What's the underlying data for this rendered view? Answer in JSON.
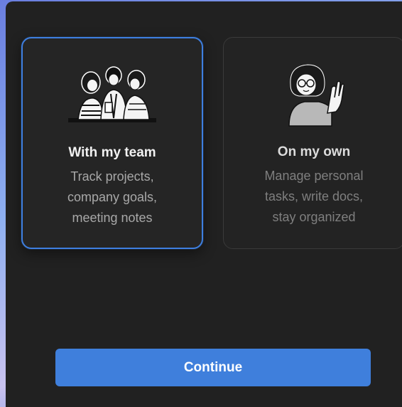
{
  "options": [
    {
      "title": "With my team",
      "description_lines": [
        "Track projects,",
        "company goals,",
        "meeting notes"
      ],
      "selected": true,
      "icon": "team-illustration-icon"
    },
    {
      "title": "On my own",
      "description_lines": [
        "Manage personal",
        "tasks, write docs,",
        "stay organized"
      ],
      "selected": false,
      "icon": "solo-illustration-icon"
    }
  ],
  "continue_label": "Continue",
  "colors": {
    "accent": "#3f7fdc",
    "panel_bg": "#212121",
    "selected_border": "#3e7fe0"
  }
}
